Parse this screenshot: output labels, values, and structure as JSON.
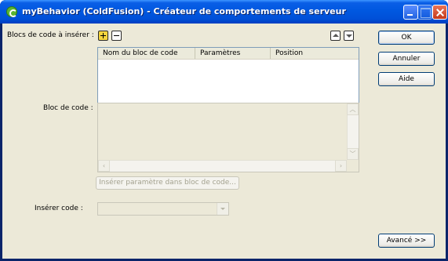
{
  "window": {
    "title": "myBehavior (ColdFusion) - Créateur de comportements de serveur"
  },
  "code_blocks": {
    "label": "Blocs de code à insérer :",
    "columns": [
      "Nom du bloc de code",
      "Paramètres",
      "Position"
    ],
    "rows": []
  },
  "code_block": {
    "label": "Bloc de code :",
    "value": ""
  },
  "insert_param": {
    "label": "Insérer paramètre dans bloc de code..."
  },
  "insert_code": {
    "label": "Insérer code :",
    "value": ""
  },
  "buttons": {
    "ok": "OK",
    "cancel": "Annuler",
    "help": "Aide",
    "advanced": "Avancé >>"
  },
  "icons": {
    "add": "plus-icon",
    "remove": "minus-icon",
    "move_up": "arrow-up-icon",
    "move_down": "arrow-down-icon"
  }
}
